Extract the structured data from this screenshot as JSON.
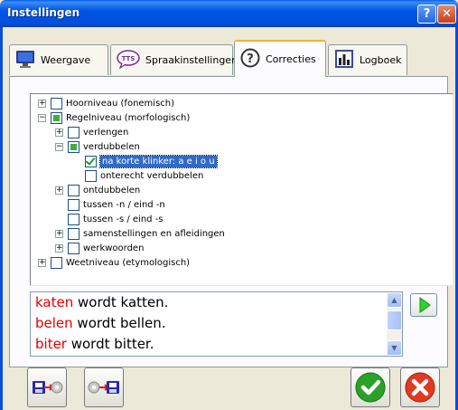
{
  "window": {
    "title": "Instellingen"
  },
  "titlebar": {
    "help_glyph": "?",
    "close_glyph": "✕"
  },
  "tabs": [
    {
      "label": "Weergave",
      "icon": "monitor-icon",
      "active": false
    },
    {
      "label": "Spraakinstellingen",
      "icon": "tts-icon",
      "icon_text": "TTS",
      "active": false
    },
    {
      "label": "Correcties",
      "icon": "question-icon",
      "icon_text": "?",
      "active": true
    },
    {
      "label": "Logboek",
      "icon": "bar-chart-icon",
      "active": false
    }
  ],
  "tree": {
    "nodes": [
      {
        "label": "Hoorniveau (fonemisch)",
        "expander": "+",
        "state": "unchecked"
      },
      {
        "label": "Regelniveau (morfologisch)",
        "expander": "−",
        "state": "partial"
      },
      {
        "label": "verlengen",
        "expander": "+",
        "state": "unchecked"
      },
      {
        "label": "verdubbelen",
        "expander": "−",
        "state": "partial"
      },
      {
        "label": "na korte klinker: a e i o u",
        "expander": "",
        "state": "checked",
        "selected": true
      },
      {
        "label": "onterecht verdubbelen",
        "expander": "",
        "state": "unchecked"
      },
      {
        "label": "ontdubbelen",
        "expander": "+",
        "state": "unchecked"
      },
      {
        "label": "tussen -n / eind -n",
        "expander": "",
        "state": "unchecked"
      },
      {
        "label": "tussen -s / eind -s",
        "expander": "",
        "state": "unchecked"
      },
      {
        "label": "samenstellingen en afleidingen",
        "expander": "+",
        "state": "unchecked"
      },
      {
        "label": "werkwoorden",
        "expander": "+",
        "state": "unchecked"
      },
      {
        "label": "Weetniveau (etymologisch)",
        "expander": "+",
        "state": "unchecked"
      }
    ]
  },
  "examples": [
    {
      "wrong": "katen",
      "rest": " wordt katten."
    },
    {
      "wrong": "belen",
      "rest": " wordt bellen."
    },
    {
      "wrong": "biter",
      "rest": " wordt bitter."
    }
  ],
  "colors": {
    "error_red": "#e00000",
    "title_blue": "#0054e3",
    "ok_green": "#2aa22a",
    "cancel_red": "#e23a22",
    "selection": "#316ac5"
  }
}
